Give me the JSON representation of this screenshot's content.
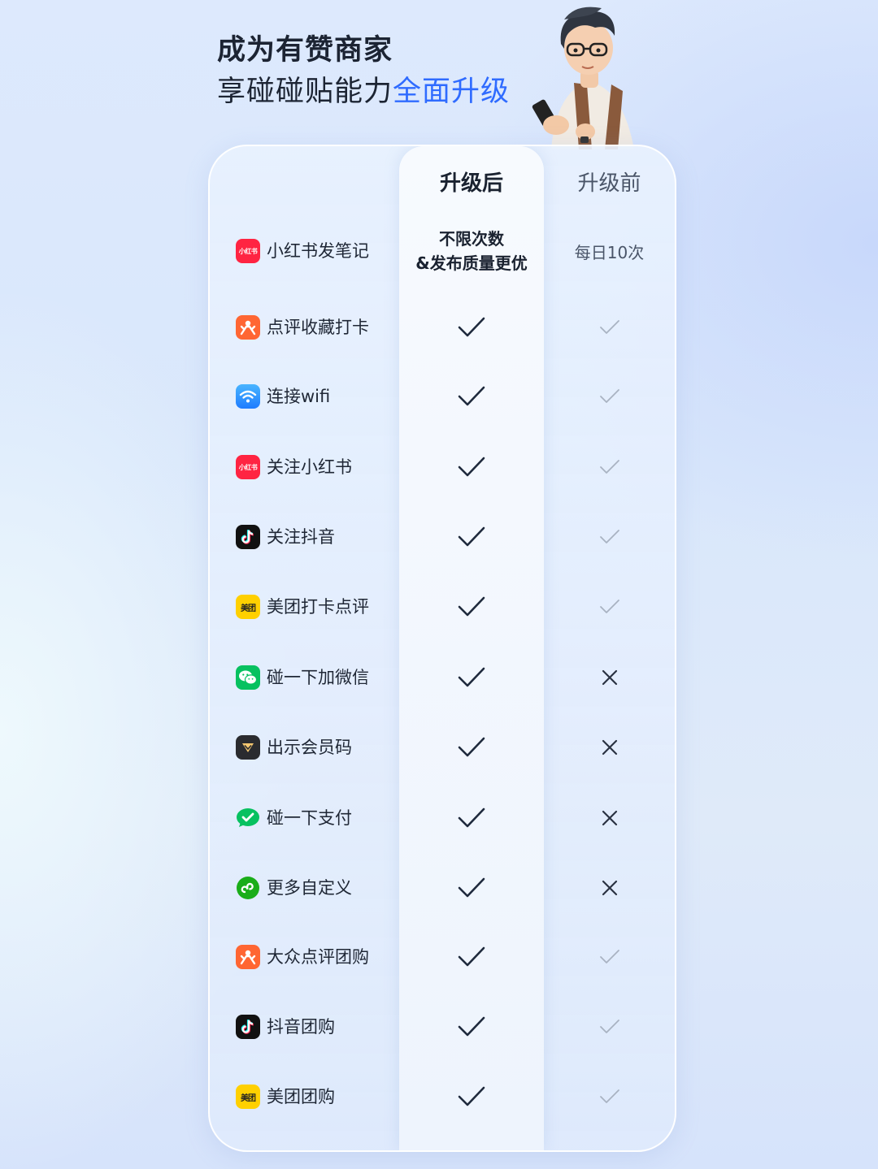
{
  "header": {
    "line1": "成为有赞商家",
    "line2_prefix": "享碰碰贴能力",
    "line2_accent": "全面升级"
  },
  "table": {
    "col_after": "升级后",
    "col_before": "升级前",
    "rows": [
      {
        "icon": "xiaohongshu-icon",
        "icon_text": "小红书",
        "label": "小红书发笔记",
        "after_line1": "不限次数",
        "after_line2": "&发布质量更优",
        "before": "每日10次"
      },
      {
        "icon": "dianping-icon",
        "label": "点评收藏打卡",
        "after": "check",
        "before": "check-light"
      },
      {
        "icon": "wifi-icon",
        "label": "连接wifi",
        "after": "check",
        "before": "check-light"
      },
      {
        "icon": "xiaohongshu-icon",
        "icon_text": "小红书",
        "label": "关注小红书",
        "after": "check",
        "before": "check-light"
      },
      {
        "icon": "douyin-icon",
        "label": "关注抖音",
        "after": "check",
        "before": "check-light"
      },
      {
        "icon": "meituan-icon",
        "icon_text": "美团",
        "label": "美团打卡点评",
        "after": "check",
        "before": "check-light"
      },
      {
        "icon": "wechat-icon",
        "label": "碰一下加微信",
        "after": "check",
        "before": "cross"
      },
      {
        "icon": "member-code-icon",
        "label": "出示会员码",
        "after": "check",
        "before": "cross"
      },
      {
        "icon": "wechat-pay-icon",
        "label": "碰一下支付",
        "after": "check",
        "before": "cross"
      },
      {
        "icon": "mini-program-icon",
        "label": "更多自定义",
        "after": "check",
        "before": "cross"
      },
      {
        "icon": "dianping-icon",
        "label": "大众点评团购",
        "after": "check",
        "before": "check-light"
      },
      {
        "icon": "douyin-icon",
        "label": "抖音团购",
        "after": "check",
        "before": "check-light"
      },
      {
        "icon": "meituan-icon",
        "icon_text": "美团",
        "label": "美团团购",
        "after": "check",
        "before": "check-light"
      }
    ]
  },
  "colors": {
    "accent": "#2f6bff",
    "check_dark": "#1f2a3d",
    "check_light": "#a9b3c2"
  }
}
